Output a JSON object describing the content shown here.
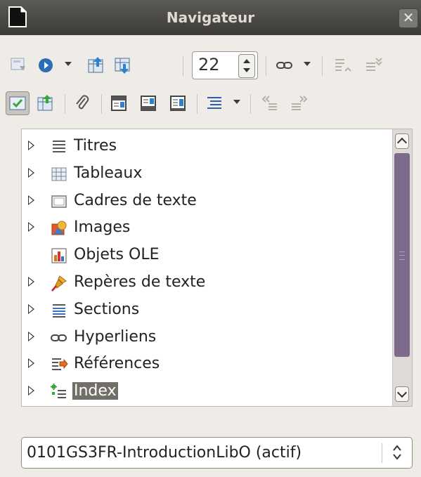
{
  "window": {
    "title": "Navigateur",
    "close_icon": "close-icon"
  },
  "toolbar1": {
    "page_number": "22",
    "icons": [
      "toggle-content-icon",
      "navigation-icon",
      "previous-icon",
      "next-icon",
      "page-spinner",
      "drag-mode-icon",
      "promote-icon",
      "demote-icon"
    ]
  },
  "toolbar2": {
    "icons": [
      "list-box-on-off-icon",
      "content-view-icon",
      "reminder-icon",
      "header-icon",
      "footer-icon",
      "anchor-icon",
      "outline-level-icon",
      "chapter-up-icon",
      "chapter-down-icon"
    ]
  },
  "tree": {
    "items": [
      {
        "label": "Titres",
        "icon": "headings-icon",
        "expandable": true
      },
      {
        "label": "Tableaux",
        "icon": "tables-icon",
        "expandable": true
      },
      {
        "label": "Cadres de texte",
        "icon": "text-frames-icon",
        "expandable": true
      },
      {
        "label": "Images",
        "icon": "images-icon",
        "expandable": true
      },
      {
        "label": "Objets OLE",
        "icon": "ole-objects-icon",
        "expandable": false
      },
      {
        "label": "Repères de texte",
        "icon": "bookmarks-icon",
        "expandable": true
      },
      {
        "label": "Sections",
        "icon": "sections-icon",
        "expandable": true
      },
      {
        "label": "Hyperliens",
        "icon": "hyperlinks-icon",
        "expandable": true
      },
      {
        "label": "Références",
        "icon": "references-icon",
        "expandable": true
      },
      {
        "label": "Index",
        "icon": "indexes-icon",
        "expandable": true,
        "selected": true
      }
    ]
  },
  "document_select": {
    "value": "0101GS3FR-IntroductionLibO (actif)"
  }
}
